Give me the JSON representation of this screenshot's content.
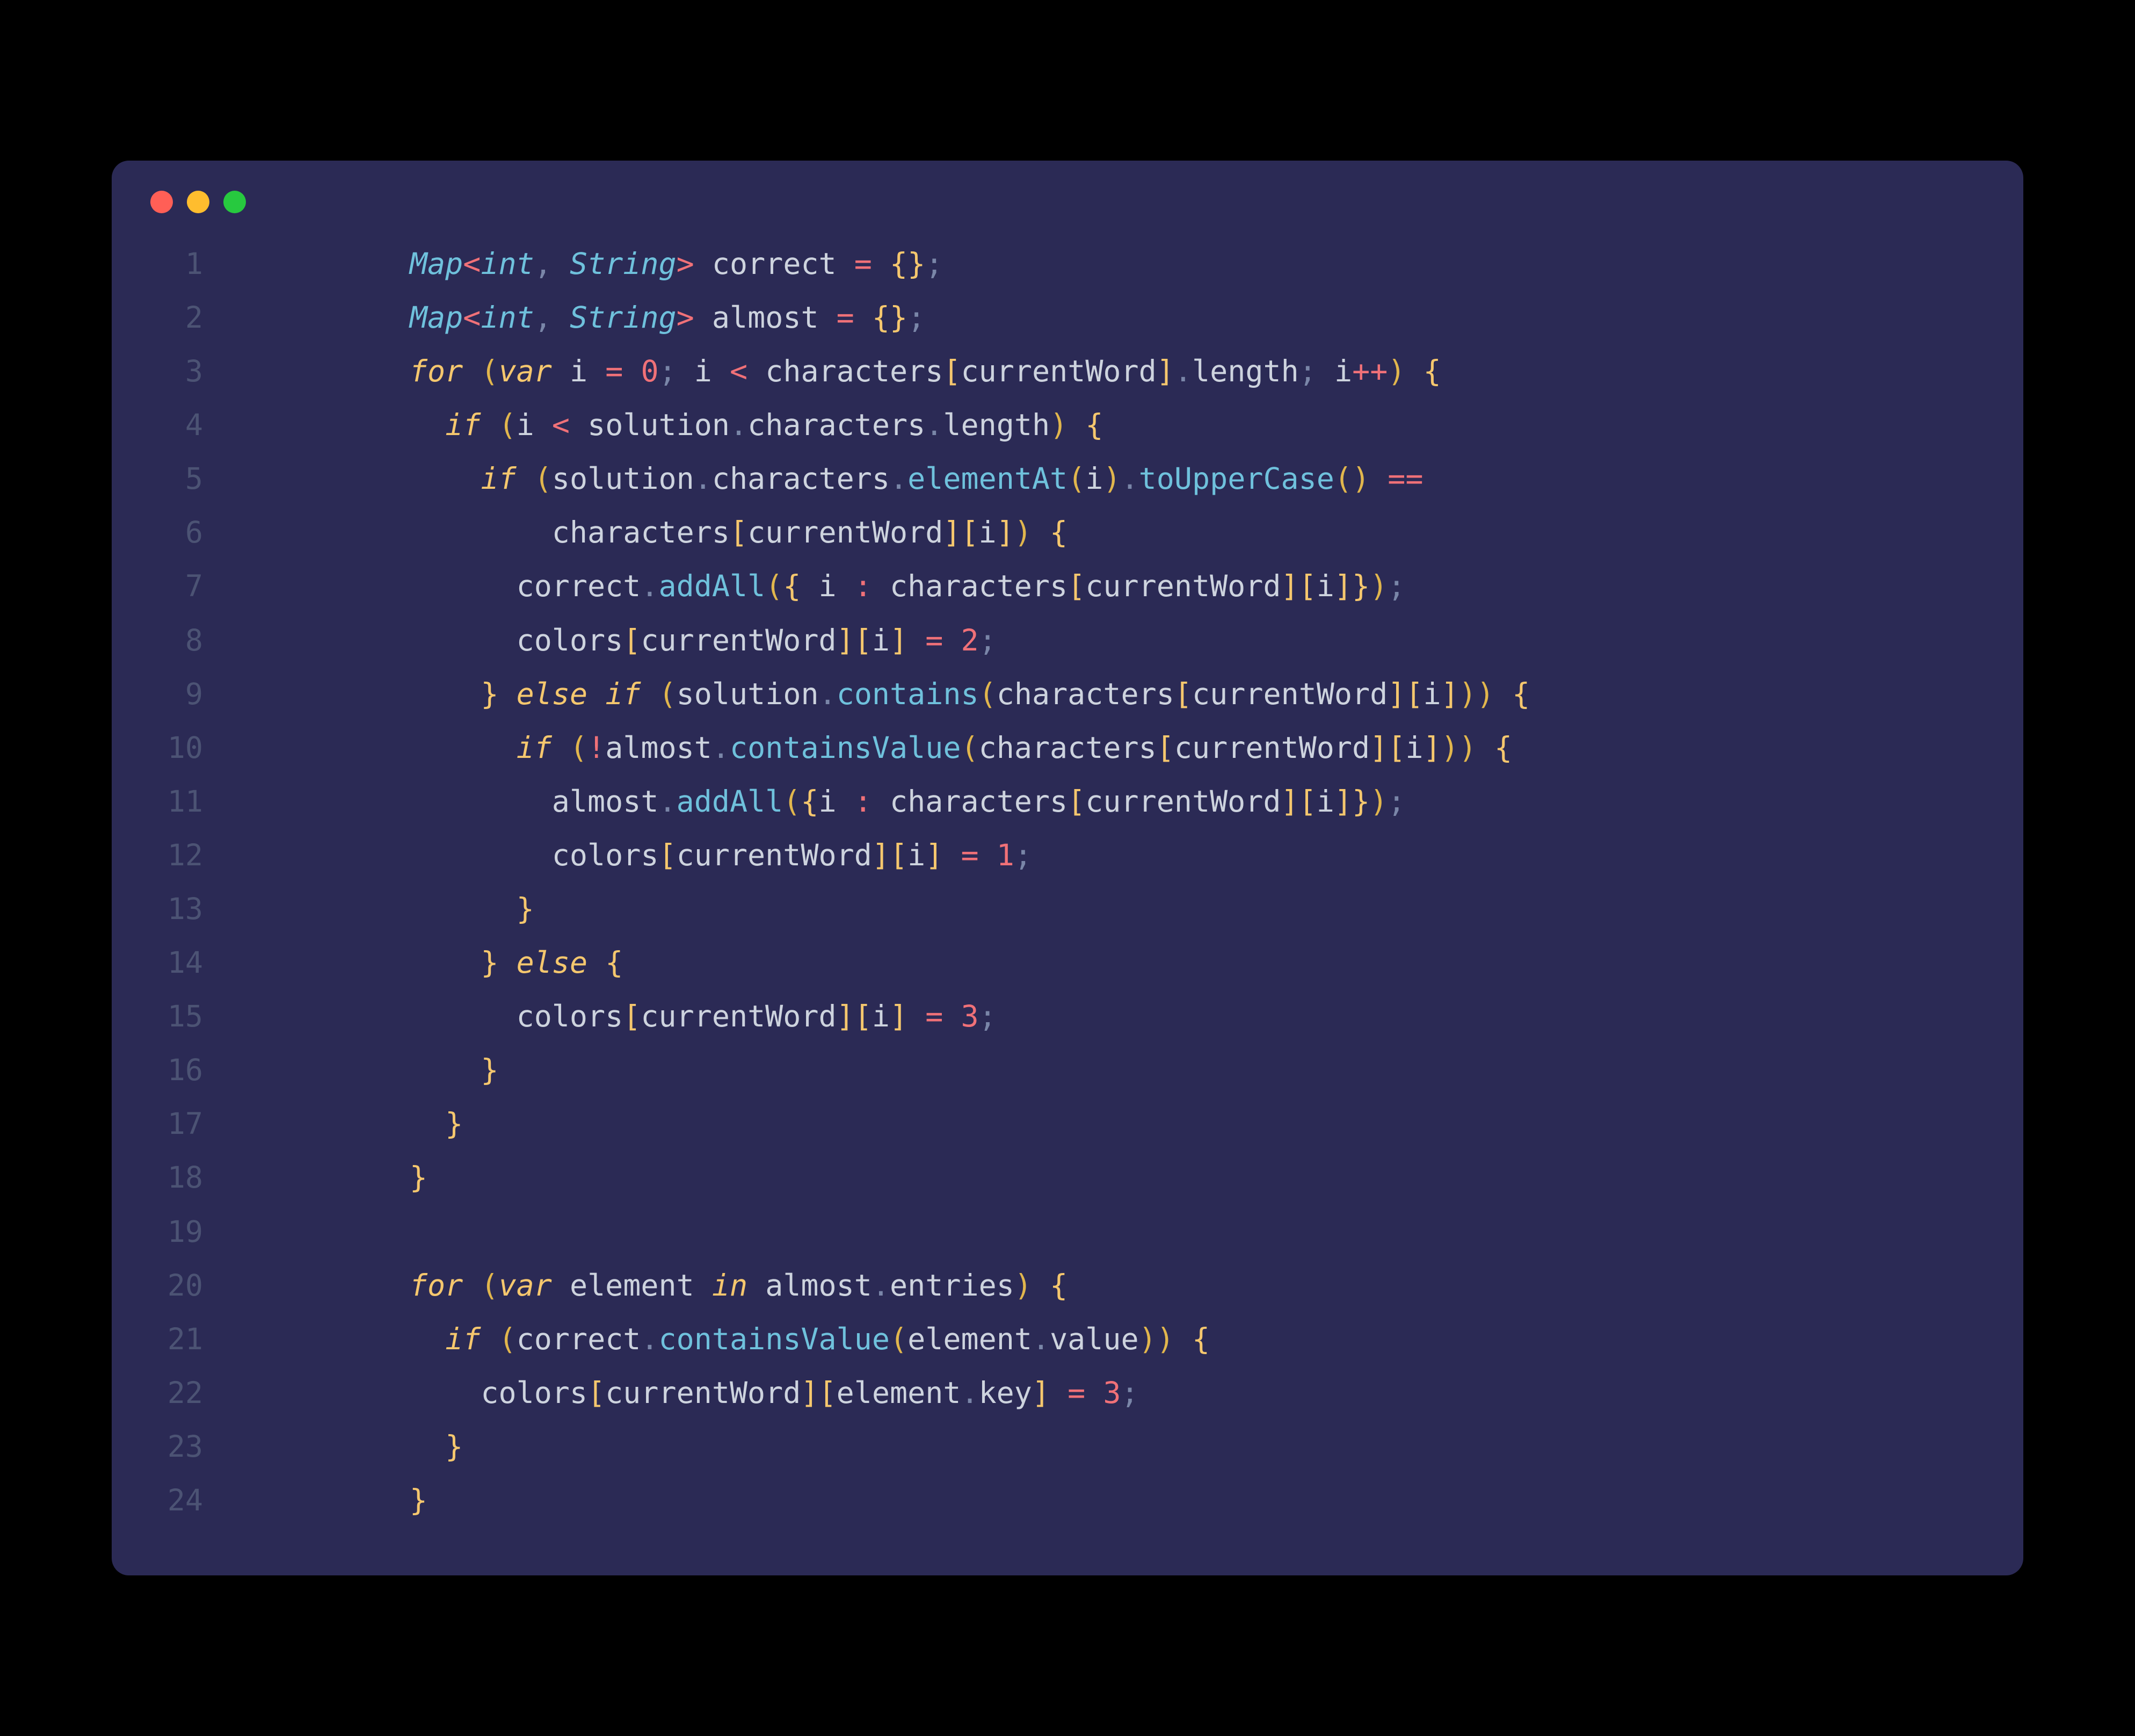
{
  "window": {
    "traffic_lights": [
      "close",
      "minimize",
      "zoom"
    ]
  },
  "code": {
    "language": "dart",
    "line_count": 24,
    "plain_text": "        Map<int, String> correct = {};\n        Map<int, String> almost = {};\n        for (var i = 0; i < characters[currentWord].length; i++) {\n          if (i < solution.characters.length) {\n            if (solution.characters.elementAt(i).toUpperCase() ==\n                characters[currentWord][i]) {\n              correct.addAll({ i : characters[currentWord][i]});\n              colors[currentWord][i] = 2;\n            } else if (solution.contains(characters[currentWord][i])) {\n              if (!almost.containsValue(characters[currentWord][i])) {\n                almost.addAll({i : characters[currentWord][i]});\n                colors[currentWord][i] = 1;\n              }\n            } else {\n              colors[currentWord][i] = 3;\n            }\n          }\n        }\n\n        for (var element in almost.entries) {\n          if (correct.containsValue(element.value)) {\n            colors[currentWord][element.key] = 3;\n          }\n        }",
    "lines": [
      {
        "n": 1,
        "tokens": [
          [
            "pln",
            "        "
          ],
          [
            "typ",
            "Map"
          ],
          [
            "ang",
            "<"
          ],
          [
            "typ",
            "int"
          ],
          [
            "pun",
            ", "
          ],
          [
            "typ",
            "String"
          ],
          [
            "ang",
            ">"
          ],
          [
            "pln",
            " correct "
          ],
          [
            "op",
            "="
          ],
          [
            "pln",
            " "
          ],
          [
            "brk",
            "{}"
          ],
          [
            "pun",
            ";"
          ]
        ]
      },
      {
        "n": 2,
        "tokens": [
          [
            "pln",
            "        "
          ],
          [
            "typ",
            "Map"
          ],
          [
            "ang",
            "<"
          ],
          [
            "typ",
            "int"
          ],
          [
            "pun",
            ", "
          ],
          [
            "typ",
            "String"
          ],
          [
            "ang",
            ">"
          ],
          [
            "pln",
            " almost "
          ],
          [
            "op",
            "="
          ],
          [
            "pln",
            " "
          ],
          [
            "brk",
            "{}"
          ],
          [
            "pun",
            ";"
          ]
        ]
      },
      {
        "n": 3,
        "tokens": [
          [
            "pln",
            "        "
          ],
          [
            "kw",
            "for"
          ],
          [
            "pln",
            " "
          ],
          [
            "par",
            "("
          ],
          [
            "kw",
            "var"
          ],
          [
            "pln",
            " i "
          ],
          [
            "op",
            "="
          ],
          [
            "pln",
            " "
          ],
          [
            "num",
            "0"
          ],
          [
            "pun",
            "; "
          ],
          [
            "pln",
            "i "
          ],
          [
            "op",
            "<"
          ],
          [
            "pln",
            " characters"
          ],
          [
            "brk",
            "["
          ],
          [
            "pln",
            "currentWord"
          ],
          [
            "brk",
            "]"
          ],
          [
            "pun",
            "."
          ],
          [
            "prop",
            "length"
          ],
          [
            "pun",
            "; "
          ],
          [
            "pln",
            "i"
          ],
          [
            "op",
            "++"
          ],
          [
            "par",
            ")"
          ],
          [
            "pln",
            " "
          ],
          [
            "brk",
            "{"
          ]
        ]
      },
      {
        "n": 4,
        "tokens": [
          [
            "pln",
            "          "
          ],
          [
            "kw",
            "if"
          ],
          [
            "pln",
            " "
          ],
          [
            "par",
            "("
          ],
          [
            "pln",
            "i "
          ],
          [
            "op",
            "<"
          ],
          [
            "pln",
            " solution"
          ],
          [
            "pun",
            "."
          ],
          [
            "prop",
            "characters"
          ],
          [
            "pun",
            "."
          ],
          [
            "prop",
            "length"
          ],
          [
            "par",
            ")"
          ],
          [
            "pln",
            " "
          ],
          [
            "brk",
            "{"
          ]
        ]
      },
      {
        "n": 5,
        "tokens": [
          [
            "pln",
            "            "
          ],
          [
            "kw",
            "if"
          ],
          [
            "pln",
            " "
          ],
          [
            "par",
            "("
          ],
          [
            "pln",
            "solution"
          ],
          [
            "pun",
            "."
          ],
          [
            "prop",
            "characters"
          ],
          [
            "pun",
            "."
          ],
          [
            "fn",
            "elementAt"
          ],
          [
            "par",
            "("
          ],
          [
            "pln",
            "i"
          ],
          [
            "par",
            ")"
          ],
          [
            "pun",
            "."
          ],
          [
            "fn",
            "toUpperCase"
          ],
          [
            "par",
            "()"
          ],
          [
            "pln",
            " "
          ],
          [
            "op",
            "=="
          ]
        ]
      },
      {
        "n": 6,
        "tokens": [
          [
            "pln",
            "                characters"
          ],
          [
            "brk",
            "["
          ],
          [
            "pln",
            "currentWord"
          ],
          [
            "brk",
            "]["
          ],
          [
            "pln",
            "i"
          ],
          [
            "brk",
            "]"
          ],
          [
            "par",
            ")"
          ],
          [
            "pln",
            " "
          ],
          [
            "brk",
            "{"
          ]
        ]
      },
      {
        "n": 7,
        "tokens": [
          [
            "pln",
            "              correct"
          ],
          [
            "pun",
            "."
          ],
          [
            "fn",
            "addAll"
          ],
          [
            "par",
            "("
          ],
          [
            "brk",
            "{"
          ],
          [
            "pln",
            " i "
          ],
          [
            "op",
            ":"
          ],
          [
            "pln",
            " characters"
          ],
          [
            "brk",
            "["
          ],
          [
            "pln",
            "currentWord"
          ],
          [
            "brk",
            "]["
          ],
          [
            "pln",
            "i"
          ],
          [
            "brk",
            "]}"
          ],
          [
            "par",
            ")"
          ],
          [
            "pun",
            ";"
          ]
        ]
      },
      {
        "n": 8,
        "tokens": [
          [
            "pln",
            "              colors"
          ],
          [
            "brk",
            "["
          ],
          [
            "pln",
            "currentWord"
          ],
          [
            "brk",
            "]["
          ],
          [
            "pln",
            "i"
          ],
          [
            "brk",
            "]"
          ],
          [
            "pln",
            " "
          ],
          [
            "op",
            "="
          ],
          [
            "pln",
            " "
          ],
          [
            "num",
            "2"
          ],
          [
            "pun",
            ";"
          ]
        ]
      },
      {
        "n": 9,
        "tokens": [
          [
            "pln",
            "            "
          ],
          [
            "brk",
            "}"
          ],
          [
            "pln",
            " "
          ],
          [
            "kw",
            "else"
          ],
          [
            "pln",
            " "
          ],
          [
            "kw",
            "if"
          ],
          [
            "pln",
            " "
          ],
          [
            "par",
            "("
          ],
          [
            "pln",
            "solution"
          ],
          [
            "pun",
            "."
          ],
          [
            "fn",
            "contains"
          ],
          [
            "par",
            "("
          ],
          [
            "pln",
            "characters"
          ],
          [
            "brk",
            "["
          ],
          [
            "pln",
            "currentWord"
          ],
          [
            "brk",
            "]["
          ],
          [
            "pln",
            "i"
          ],
          [
            "brk",
            "]"
          ],
          [
            "par",
            "))"
          ],
          [
            "pln",
            " "
          ],
          [
            "brk",
            "{"
          ]
        ]
      },
      {
        "n": 10,
        "tokens": [
          [
            "pln",
            "              "
          ],
          [
            "kw",
            "if"
          ],
          [
            "pln",
            " "
          ],
          [
            "par",
            "("
          ],
          [
            "op",
            "!"
          ],
          [
            "pln",
            "almost"
          ],
          [
            "pun",
            "."
          ],
          [
            "fn",
            "containsValue"
          ],
          [
            "par",
            "("
          ],
          [
            "pln",
            "characters"
          ],
          [
            "brk",
            "["
          ],
          [
            "pln",
            "currentWord"
          ],
          [
            "brk",
            "]["
          ],
          [
            "pln",
            "i"
          ],
          [
            "brk",
            "]"
          ],
          [
            "par",
            "))"
          ],
          [
            "pln",
            " "
          ],
          [
            "brk",
            "{"
          ]
        ]
      },
      {
        "n": 11,
        "tokens": [
          [
            "pln",
            "                almost"
          ],
          [
            "pun",
            "."
          ],
          [
            "fn",
            "addAll"
          ],
          [
            "par",
            "("
          ],
          [
            "brk",
            "{"
          ],
          [
            "pln",
            "i "
          ],
          [
            "op",
            ":"
          ],
          [
            "pln",
            " characters"
          ],
          [
            "brk",
            "["
          ],
          [
            "pln",
            "currentWord"
          ],
          [
            "brk",
            "]["
          ],
          [
            "pln",
            "i"
          ],
          [
            "brk",
            "]}"
          ],
          [
            "par",
            ")"
          ],
          [
            "pun",
            ";"
          ]
        ]
      },
      {
        "n": 12,
        "tokens": [
          [
            "pln",
            "                colors"
          ],
          [
            "brk",
            "["
          ],
          [
            "pln",
            "currentWord"
          ],
          [
            "brk",
            "]["
          ],
          [
            "pln",
            "i"
          ],
          [
            "brk",
            "]"
          ],
          [
            "pln",
            " "
          ],
          [
            "op",
            "="
          ],
          [
            "pln",
            " "
          ],
          [
            "num",
            "1"
          ],
          [
            "pun",
            ";"
          ]
        ]
      },
      {
        "n": 13,
        "tokens": [
          [
            "pln",
            "              "
          ],
          [
            "brk",
            "}"
          ]
        ]
      },
      {
        "n": 14,
        "tokens": [
          [
            "pln",
            "            "
          ],
          [
            "brk",
            "}"
          ],
          [
            "pln",
            " "
          ],
          [
            "kw",
            "else"
          ],
          [
            "pln",
            " "
          ],
          [
            "brk",
            "{"
          ]
        ]
      },
      {
        "n": 15,
        "tokens": [
          [
            "pln",
            "              colors"
          ],
          [
            "brk",
            "["
          ],
          [
            "pln",
            "currentWord"
          ],
          [
            "brk",
            "]["
          ],
          [
            "pln",
            "i"
          ],
          [
            "brk",
            "]"
          ],
          [
            "pln",
            " "
          ],
          [
            "op",
            "="
          ],
          [
            "pln",
            " "
          ],
          [
            "num",
            "3"
          ],
          [
            "pun",
            ";"
          ]
        ]
      },
      {
        "n": 16,
        "tokens": [
          [
            "pln",
            "            "
          ],
          [
            "brk",
            "}"
          ]
        ]
      },
      {
        "n": 17,
        "tokens": [
          [
            "pln",
            "          "
          ],
          [
            "brk",
            "}"
          ]
        ]
      },
      {
        "n": 18,
        "tokens": [
          [
            "pln",
            "        "
          ],
          [
            "brk",
            "}"
          ]
        ]
      },
      {
        "n": 19,
        "tokens": [
          [
            "pln",
            ""
          ]
        ]
      },
      {
        "n": 20,
        "tokens": [
          [
            "pln",
            "        "
          ],
          [
            "kw",
            "for"
          ],
          [
            "pln",
            " "
          ],
          [
            "par",
            "("
          ],
          [
            "kw",
            "var"
          ],
          [
            "pln",
            " element "
          ],
          [
            "kw",
            "in"
          ],
          [
            "pln",
            " almost"
          ],
          [
            "pun",
            "."
          ],
          [
            "prop",
            "entries"
          ],
          [
            "par",
            ")"
          ],
          [
            "pln",
            " "
          ],
          [
            "brk",
            "{"
          ]
        ]
      },
      {
        "n": 21,
        "tokens": [
          [
            "pln",
            "          "
          ],
          [
            "kw",
            "if"
          ],
          [
            "pln",
            " "
          ],
          [
            "par",
            "("
          ],
          [
            "pln",
            "correct"
          ],
          [
            "pun",
            "."
          ],
          [
            "fn",
            "containsValue"
          ],
          [
            "par",
            "("
          ],
          [
            "pln",
            "element"
          ],
          [
            "pun",
            "."
          ],
          [
            "prop",
            "value"
          ],
          [
            "par",
            "))"
          ],
          [
            "pln",
            " "
          ],
          [
            "brk",
            "{"
          ]
        ]
      },
      {
        "n": 22,
        "tokens": [
          [
            "pln",
            "            colors"
          ],
          [
            "brk",
            "["
          ],
          [
            "pln",
            "currentWord"
          ],
          [
            "brk",
            "]["
          ],
          [
            "pln",
            "element"
          ],
          [
            "pun",
            "."
          ],
          [
            "prop",
            "key"
          ],
          [
            "brk",
            "]"
          ],
          [
            "pln",
            " "
          ],
          [
            "op",
            "="
          ],
          [
            "pln",
            " "
          ],
          [
            "num",
            "3"
          ],
          [
            "pun",
            ";"
          ]
        ]
      },
      {
        "n": 23,
        "tokens": [
          [
            "pln",
            "          "
          ],
          [
            "brk",
            "}"
          ]
        ]
      },
      {
        "n": 24,
        "tokens": [
          [
            "pln",
            "        "
          ],
          [
            "brk",
            "}"
          ]
        ]
      }
    ]
  }
}
